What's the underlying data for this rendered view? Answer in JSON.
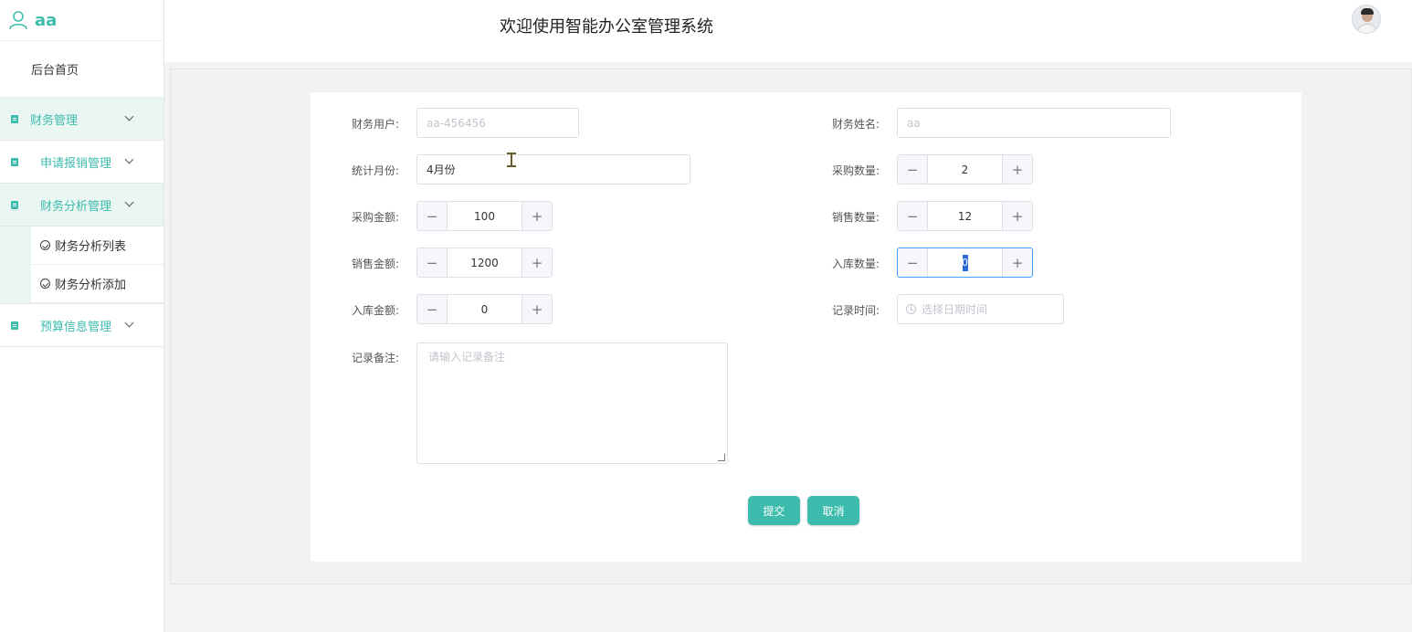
{
  "brand": {
    "username": "aa"
  },
  "sidebar": {
    "home": "后台首页",
    "groups": [
      {
        "label": "财务管理"
      },
      {
        "label": "申请报销管理"
      },
      {
        "label": "财务分析管理",
        "items": [
          "财务分析列表",
          "财务分析添加"
        ]
      },
      {
        "label": "预算信息管理"
      }
    ]
  },
  "header": {
    "title": "欢迎使用智能办公室管理系统"
  },
  "form": {
    "finance_user": {
      "label": "财务用户:",
      "placeholder": "aa-456456"
    },
    "finance_name": {
      "label": "财务姓名:",
      "placeholder": "aa"
    },
    "stat_month": {
      "label": "统计月份:",
      "value": "4月份"
    },
    "purchase_qty": {
      "label": "采购数量:",
      "value": "2"
    },
    "purchase_amount": {
      "label": "采购金额:",
      "value": "100"
    },
    "sales_qty": {
      "label": "销售数量:",
      "value": "12"
    },
    "sales_amount": {
      "label": "销售金额:",
      "value": "1200"
    },
    "stock_in_qty": {
      "label": "入库数量:",
      "value": "0"
    },
    "stock_in_amount": {
      "label": "入库金额:",
      "value": "0"
    },
    "record_time": {
      "label": "记录时间:",
      "placeholder": "选择日期时间"
    },
    "record_note": {
      "label": "记录备注:",
      "placeholder": "请输入记录备注"
    },
    "submit": "提交",
    "cancel": "取消",
    "minus_symbol": "−",
    "plus_symbol": "+"
  },
  "colors": {
    "accent": "#3dbbad",
    "focus": "#409eff"
  }
}
